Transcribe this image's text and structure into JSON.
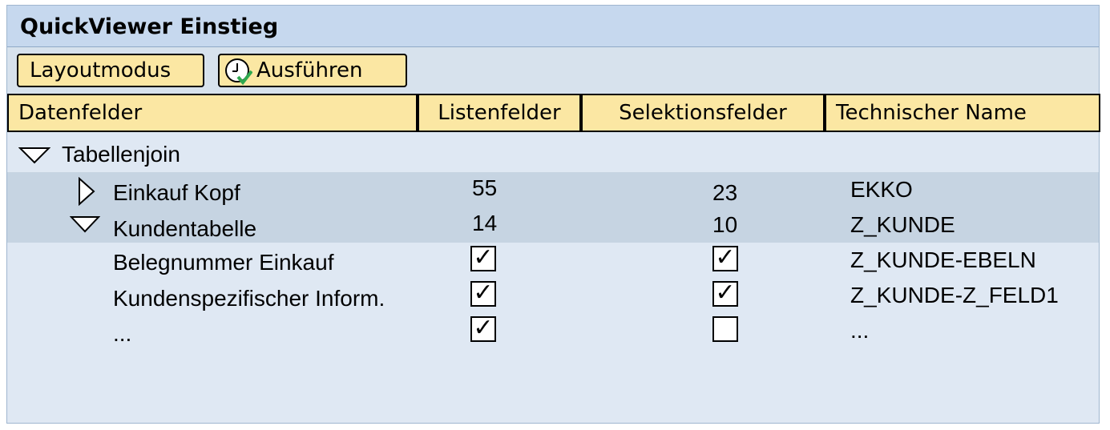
{
  "window": {
    "title": "QuickViewer Einstieg"
  },
  "toolbar": {
    "layout_label": "Layoutmodus",
    "run_label": "Ausführen"
  },
  "columns": [
    "Datenfelder",
    "Listenfelder",
    "Selektionsfelder",
    "Technischer Name"
  ],
  "tree": {
    "root": "Tabellenjoin",
    "einkauf": {
      "label": "Einkauf Kopf",
      "list": "55",
      "sel": "23",
      "tech": "EKKO"
    },
    "kunden": {
      "label": "Kundentabelle",
      "list": "14",
      "sel": "10",
      "tech": "Z_KUNDE"
    },
    "fields": [
      {
        "label": "Belegnummer  Einkauf",
        "list_checked": true,
        "sel_checked": true,
        "tech": "Z_KUNDE-EBELN"
      },
      {
        "label": "Kundenspezifischer  Inform.",
        "list_checked": true,
        "sel_checked": true,
        "tech": "Z_KUNDE-Z_FELD1"
      },
      {
        "label": "...",
        "list_checked": true,
        "sel_checked": false,
        "tech": "..."
      }
    ]
  },
  "colors": {
    "title_bg": "#c6d8ee",
    "button_bg": "#fbe7a3",
    "highlight_row": "#c6d4e2",
    "check_green": "#2fa84f"
  },
  "icons": {
    "expanded": "triangle-down-icon",
    "collapsed": "triangle-right-icon",
    "run": "clock-check-icon"
  }
}
